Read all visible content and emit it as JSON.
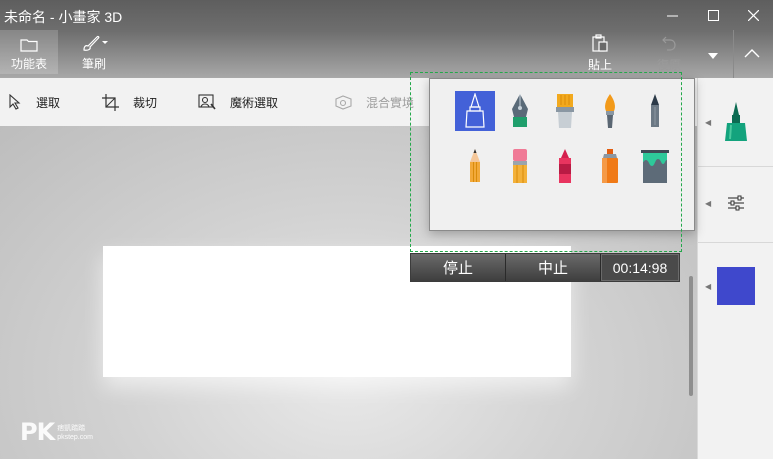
{
  "window": {
    "title": "未命名 - 小畫家 3D",
    "controls": [
      "minimize-icon",
      "maximize-icon",
      "close-icon"
    ]
  },
  "ribbon": {
    "tabs": [
      {
        "label": "功能表",
        "icon": "folder-icon",
        "active": true
      },
      {
        "label": "筆刷",
        "icon": "brush-icon",
        "active": false
      }
    ],
    "paste_label": "貼上",
    "undo_label": "復原",
    "colors": {
      "topbar": "#6a6a6a",
      "accent": "#4361d8"
    }
  },
  "toolbar": {
    "tools": [
      {
        "label": "選取",
        "icon": "select-cursor-icon",
        "enabled": true
      },
      {
        "label": "裁切",
        "icon": "crop-icon",
        "enabled": true
      },
      {
        "label": "魔術選取",
        "icon": "magic-select-icon",
        "enabled": true
      },
      {
        "label": "混合實境",
        "icon": "mixed-reality-icon",
        "enabled": false
      }
    ]
  },
  "brush_panel": {
    "brushes": [
      {
        "name": "marker",
        "icon": "marker-icon",
        "selected": true
      },
      {
        "name": "calligraphy-pen",
        "icon": "calligraphy-pen-icon",
        "selected": false
      },
      {
        "name": "oil-brush",
        "icon": "oil-brush-icon",
        "selected": false
      },
      {
        "name": "watercolor",
        "icon": "watercolor-brush-icon",
        "selected": false
      },
      {
        "name": "pixel-pen",
        "icon": "pixel-pen-icon",
        "selected": false
      },
      {
        "name": "pencil",
        "icon": "pencil-icon",
        "selected": false
      },
      {
        "name": "eraser",
        "icon": "eraser-icon",
        "selected": false
      },
      {
        "name": "crayon",
        "icon": "crayon-icon",
        "selected": false
      },
      {
        "name": "spray-can",
        "icon": "spray-can-icon",
        "selected": false
      },
      {
        "name": "fill",
        "icon": "fill-bucket-icon",
        "selected": false
      }
    ]
  },
  "side_panel": {
    "current_tool_icon": "marker-icon",
    "settings_icon": "sliders-icon",
    "selected_color": "#3f48cc"
  },
  "recorder": {
    "stop_label": "停止",
    "pause_label": "中止",
    "elapsed": "00:14:98"
  },
  "watermark": {
    "logo": "PK",
    "text": "痞凱踏踏",
    "site": "pkstep.com"
  }
}
